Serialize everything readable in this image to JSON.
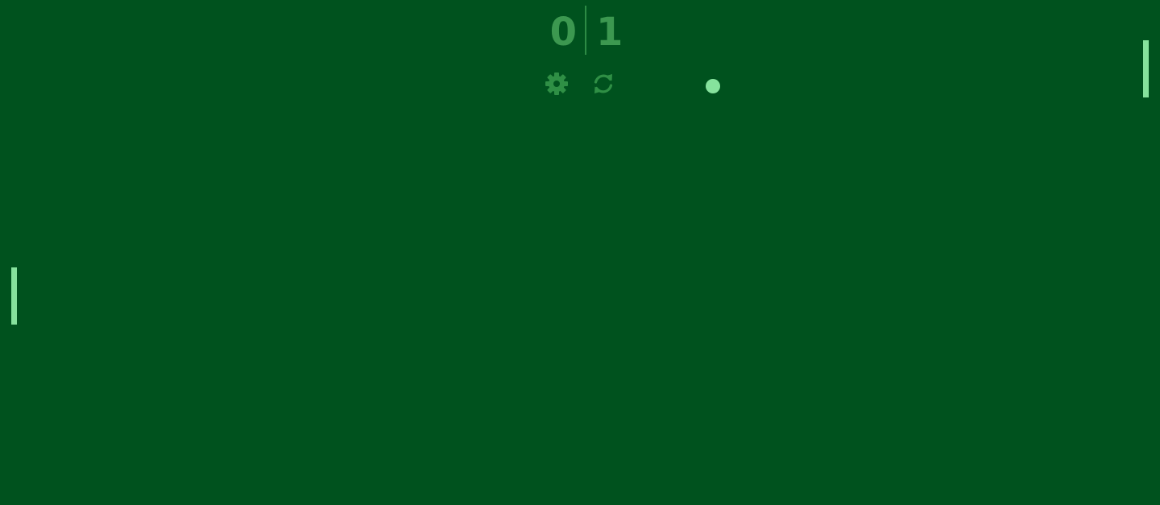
{
  "scoreboard": {
    "left_score": "0",
    "right_score": "1"
  },
  "controls": {
    "settings_icon": "gear-icon",
    "restart_icon": "refresh-icon"
  },
  "colors": {
    "background": "#00521e",
    "paddle": "#86e29d",
    "ball": "#86e29d",
    "score_text": "#3c9850",
    "icons": "#2f8f45"
  }
}
